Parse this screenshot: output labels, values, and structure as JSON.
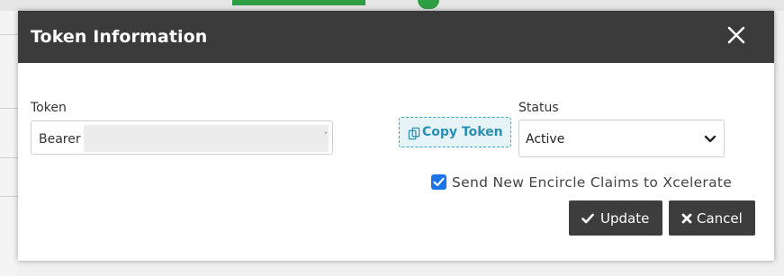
{
  "modal": {
    "title": "Token Information",
    "close_icon": "close-icon"
  },
  "token": {
    "label": "Token",
    "value_prefix": "Bearer",
    "value_suffix": "·"
  },
  "copy": {
    "label": "Copy Token",
    "icon": "copy-icon"
  },
  "status": {
    "label": "Status",
    "selected": "Active"
  },
  "checkbox": {
    "label": "Send New Encircle Claims to Xcelerate",
    "checked": true
  },
  "buttons": {
    "update_label": "Update",
    "update_icon": "check-icon",
    "cancel_label": "Cancel",
    "cancel_icon": "times-icon"
  },
  "colors": {
    "header_bg": "#3b3b3b",
    "accent_copy": "#2a8fb3",
    "checkbox": "#1a73e8",
    "button_bg": "#3d3d3d"
  }
}
